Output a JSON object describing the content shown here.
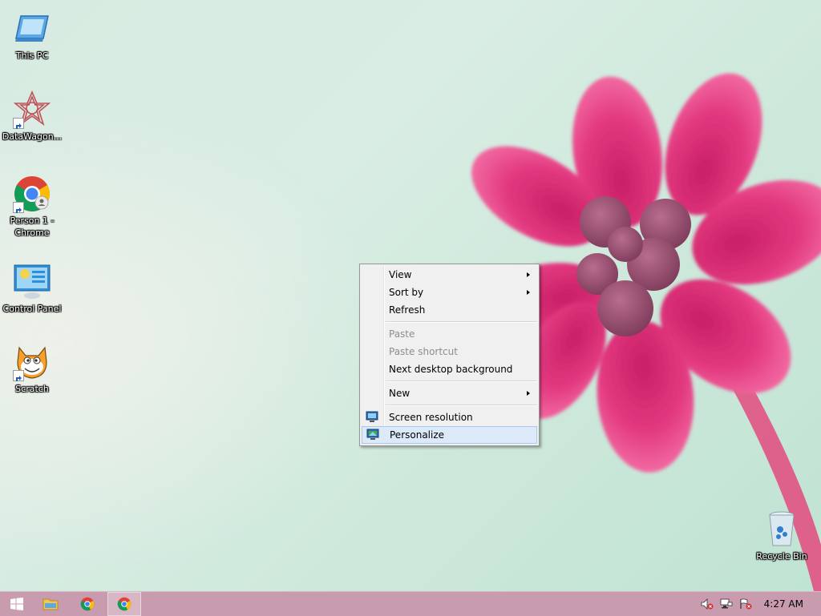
{
  "desktop_icons": [
    {
      "label": "This PC"
    },
    {
      "label": "DataWagon..."
    },
    {
      "label": "Person 1 - Chrome"
    },
    {
      "label": "Control Panel"
    },
    {
      "label": "Scratch"
    },
    {
      "label": "Recycle Bin"
    }
  ],
  "context_menu": {
    "items": [
      {
        "label": "View",
        "submenu": true
      },
      {
        "label": "Sort by",
        "submenu": true
      },
      {
        "label": "Refresh"
      },
      {
        "label": "Paste",
        "disabled": true
      },
      {
        "label": "Paste shortcut",
        "disabled": true
      },
      {
        "label": "Next desktop background"
      },
      {
        "label": "New",
        "submenu": true
      },
      {
        "label": "Screen resolution",
        "icon": "monitor-icon"
      },
      {
        "label": "Personalize",
        "icon": "personalize-icon",
        "highlighted": true
      }
    ]
  },
  "taskbar": {
    "clock": "4:27 AM"
  },
  "colors": {
    "taskbar": "#c89bae",
    "menu_highlight": "#dce9f8",
    "flower": "#e2387f"
  }
}
